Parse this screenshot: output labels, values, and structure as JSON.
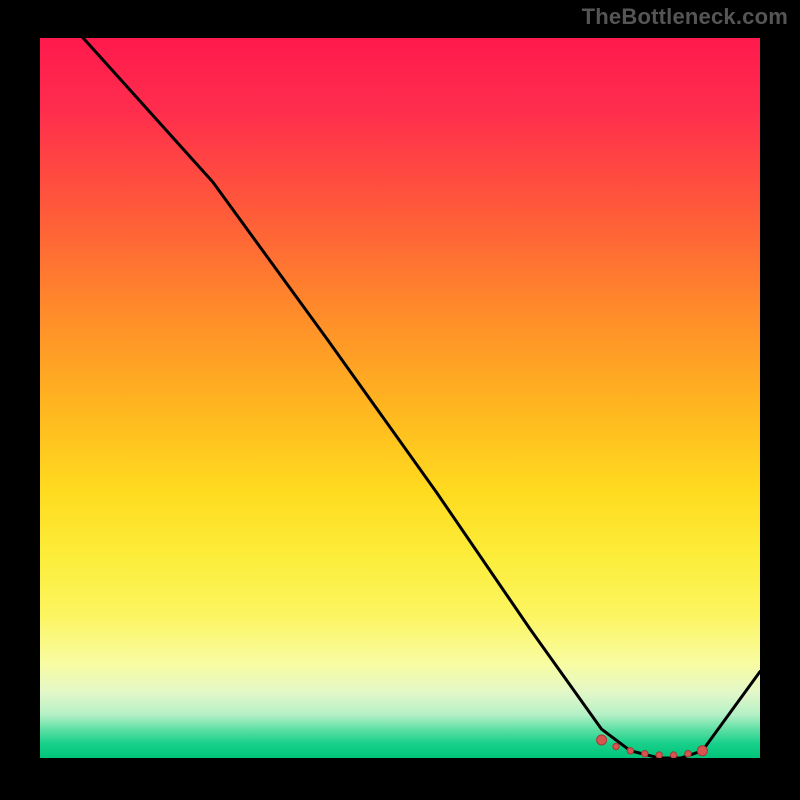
{
  "watermark": "TheBottleneck.com",
  "chart_data": {
    "type": "line",
    "title": "",
    "xlabel": "",
    "ylabel": "",
    "xlim": [
      0,
      100
    ],
    "ylim": [
      0,
      100
    ],
    "x": [
      0,
      6,
      24,
      40,
      55,
      68,
      78,
      82,
      86,
      89,
      92,
      100
    ],
    "values": [
      110,
      100,
      80,
      58,
      37,
      18,
      4,
      1,
      0,
      0,
      1,
      12
    ],
    "optimal_zone": {
      "x_points": [
        78,
        80,
        82,
        84,
        86,
        88,
        90,
        92
      ],
      "y": [
        2.5,
        1.6,
        1.0,
        0.6,
        0.4,
        0.4,
        0.6,
        1.0
      ]
    },
    "colors": {
      "line": "#000000",
      "marker": "#d9534f",
      "gradient_top": "#ff1a4d",
      "gradient_bottom": "#00c479"
    }
  }
}
